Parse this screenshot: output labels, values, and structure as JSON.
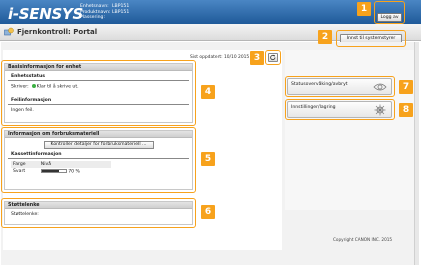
{
  "header": {
    "logo": "i-SENSYS",
    "device_name_label": "Enhetsnavn:",
    "device_name_value": "LBP151",
    "product_name_label": "Produktnavn:",
    "product_name_value": "LBP151",
    "location_label": "Plassering:",
    "location_value": "",
    "logout_label": "Logg av"
  },
  "titlebar": {
    "title": "Fjernkontroll: Portal",
    "sysadmin_label": "Innst til systemstyrer"
  },
  "status": {
    "last_updated": "Sist oppdatert: 10/10 2015",
    "basic_info_heading": "Basisinformasjon for enhet",
    "device_status_heading": "Enhetsstatus",
    "printer_label": "Skriver:",
    "printer_status": "Klar til å skrive ut.",
    "error_info_heading": "Feilinformasjon",
    "error_info_value": "Ingen feil."
  },
  "consumables": {
    "heading": "Informasjon om forbruksmateriell",
    "check_button": "Kontroller detaljer for forbruksmateriell ...",
    "cartridge_heading": "Kassettinformasjon",
    "color_label": "Farge",
    "level_label": "Nivå",
    "black_label": "Svart",
    "black_level_text": "70 %",
    "black_level_fraction": 0.7
  },
  "support": {
    "heading": "Støttelenke",
    "link_label": "Støttelenke:"
  },
  "side_buttons": {
    "status_monitor": "Statusovervåking/avbryt",
    "settings": "Innstillinger/lagring"
  },
  "footer": {
    "copyright": "Copyright CANON INC. 2015"
  },
  "callouts": [
    "1",
    "2",
    "3",
    "4",
    "5",
    "6",
    "7",
    "8"
  ],
  "colors": {
    "header_blue": "#1f5a99",
    "callout_orange": "#f7a21c",
    "ready_green": "#3cb043"
  },
  "icons": {
    "portal": "portal-icon",
    "refresh": "refresh-icon",
    "status_monitor": "monitor-icon",
    "settings": "settings-icon"
  }
}
